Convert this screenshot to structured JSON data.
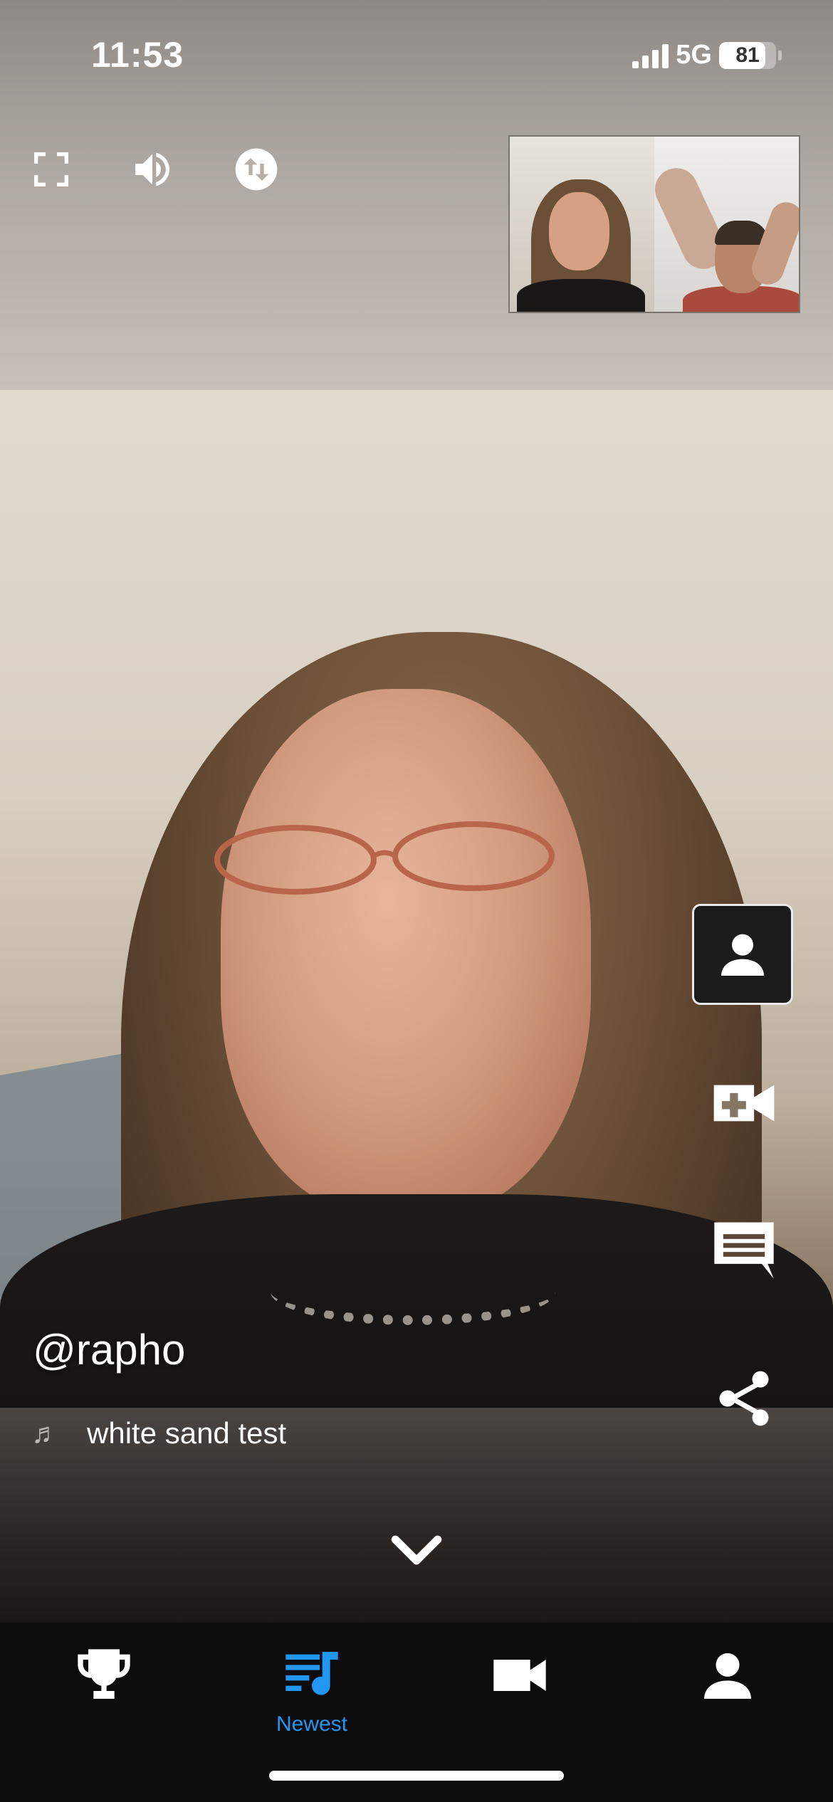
{
  "status_bar": {
    "time": "11:53",
    "network": "5G",
    "battery": "81"
  },
  "top_controls": {
    "icons": [
      "fullscreen-icon",
      "volume-icon",
      "swap-icon"
    ]
  },
  "post": {
    "username": "@rapho",
    "track_icon": "music-note-icon",
    "track_title": "white sand test"
  },
  "actions": [
    "profile-icon",
    "add-video-icon",
    "comment-icon",
    "share-icon"
  ],
  "tabbar": {
    "tabs": [
      {
        "icon": "trophy-icon",
        "label": ""
      },
      {
        "icon": "playlist-icon",
        "label": "Newest"
      },
      {
        "icon": "video-camera-icon",
        "label": ""
      },
      {
        "icon": "person-icon",
        "label": ""
      }
    ],
    "active_color": "#2196F3",
    "inactive_color": "#FFFFFF"
  }
}
